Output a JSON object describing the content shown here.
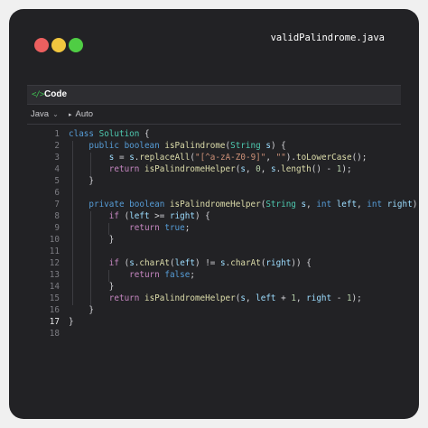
{
  "window": {
    "filename": "validPalindrome.java",
    "controls": [
      "close",
      "minimize",
      "maximize"
    ]
  },
  "panel": {
    "icon": "code-icon",
    "title": "Code",
    "language": "Java",
    "mode": "Auto"
  },
  "editor": {
    "active_line": 17,
    "line_numbers": [
      "1",
      "2",
      "3",
      "4",
      "5",
      "6",
      "7",
      "8",
      "9",
      "10",
      "11",
      "12",
      "13",
      "14",
      "15",
      "16",
      "17",
      "18"
    ],
    "lines": [
      [
        [
          "kt",
          "class "
        ],
        [
          "ty",
          "Solution"
        ],
        [
          "pl",
          " {"
        ]
      ],
      [
        [
          "pl",
          "    "
        ],
        [
          "kt",
          "public boolean "
        ],
        [
          "fn",
          "isPalindrome"
        ],
        [
          "pl",
          "("
        ],
        [
          "ty",
          "String"
        ],
        [
          "vr",
          " s"
        ],
        [
          "pl",
          ") {"
        ]
      ],
      [
        [
          "pl",
          "        "
        ],
        [
          "vr",
          "s"
        ],
        [
          "pl",
          " = "
        ],
        [
          "vr",
          "s"
        ],
        [
          "pl",
          "."
        ],
        [
          "fn",
          "replaceAll"
        ],
        [
          "pl",
          "("
        ],
        [
          "st",
          "\"[^a-zA-Z0-9]\""
        ],
        [
          "pl",
          ", "
        ],
        [
          "st",
          "\"\""
        ],
        [
          "pl",
          ")."
        ],
        [
          "fn",
          "toLowerCase"
        ],
        [
          "pl",
          "();"
        ]
      ],
      [
        [
          "pl",
          "        "
        ],
        [
          "kw",
          "return "
        ],
        [
          "fn",
          "isPalindromeHelper"
        ],
        [
          "pl",
          "("
        ],
        [
          "vr",
          "s"
        ],
        [
          "pl",
          ", "
        ],
        [
          "nm",
          "0"
        ],
        [
          "pl",
          ", "
        ],
        [
          "vr",
          "s"
        ],
        [
          "pl",
          "."
        ],
        [
          "fn",
          "length"
        ],
        [
          "pl",
          "() - "
        ],
        [
          "nm",
          "1"
        ],
        [
          "pl",
          ");"
        ]
      ],
      [
        [
          "pl",
          "    }"
        ]
      ],
      [],
      [
        [
          "pl",
          "    "
        ],
        [
          "kt",
          "private boolean "
        ],
        [
          "fn",
          "isPalindromeHelper"
        ],
        [
          "pl",
          "("
        ],
        [
          "ty",
          "String"
        ],
        [
          "vr",
          " s"
        ],
        [
          "pl",
          ", "
        ],
        [
          "kt",
          "int "
        ],
        [
          "vr",
          "left"
        ],
        [
          "pl",
          ", "
        ],
        [
          "kt",
          "int "
        ],
        [
          "vr",
          "right"
        ],
        [
          "pl",
          ") {"
        ]
      ],
      [
        [
          "pl",
          "        "
        ],
        [
          "kw",
          "if"
        ],
        [
          "pl",
          " ("
        ],
        [
          "vr",
          "left"
        ],
        [
          "pl",
          " >= "
        ],
        [
          "vr",
          "right"
        ],
        [
          "pl",
          ") {"
        ]
      ],
      [
        [
          "pl",
          "            "
        ],
        [
          "kw",
          "return "
        ],
        [
          "kt",
          "true"
        ],
        [
          "pl",
          ";"
        ]
      ],
      [
        [
          "pl",
          "        }"
        ]
      ],
      [],
      [
        [
          "pl",
          "        "
        ],
        [
          "kw",
          "if"
        ],
        [
          "pl",
          " ("
        ],
        [
          "vr",
          "s"
        ],
        [
          "pl",
          "."
        ],
        [
          "fn",
          "charAt"
        ],
        [
          "pl",
          "("
        ],
        [
          "vr",
          "left"
        ],
        [
          "pl",
          ") != "
        ],
        [
          "vr",
          "s"
        ],
        [
          "pl",
          "."
        ],
        [
          "fn",
          "charAt"
        ],
        [
          "pl",
          "("
        ],
        [
          "vr",
          "right"
        ],
        [
          "pl",
          ")) {"
        ]
      ],
      [
        [
          "pl",
          "            "
        ],
        [
          "kw",
          "return "
        ],
        [
          "kt",
          "false"
        ],
        [
          "pl",
          ";"
        ]
      ],
      [
        [
          "pl",
          "        }"
        ]
      ],
      [
        [
          "pl",
          "        "
        ],
        [
          "kw",
          "return "
        ],
        [
          "fn",
          "isPalindromeHelper"
        ],
        [
          "pl",
          "("
        ],
        [
          "vr",
          "s"
        ],
        [
          "pl",
          ", "
        ],
        [
          "vr",
          "left"
        ],
        [
          "pl",
          " + "
        ],
        [
          "nm",
          "1"
        ],
        [
          "pl",
          ", "
        ],
        [
          "vr",
          "right"
        ],
        [
          "pl",
          " - "
        ],
        [
          "nm",
          "1"
        ],
        [
          "pl",
          ");"
        ]
      ],
      [
        [
          "pl",
          "    }"
        ]
      ],
      [
        [
          "pl",
          "}"
        ]
      ],
      []
    ]
  }
}
